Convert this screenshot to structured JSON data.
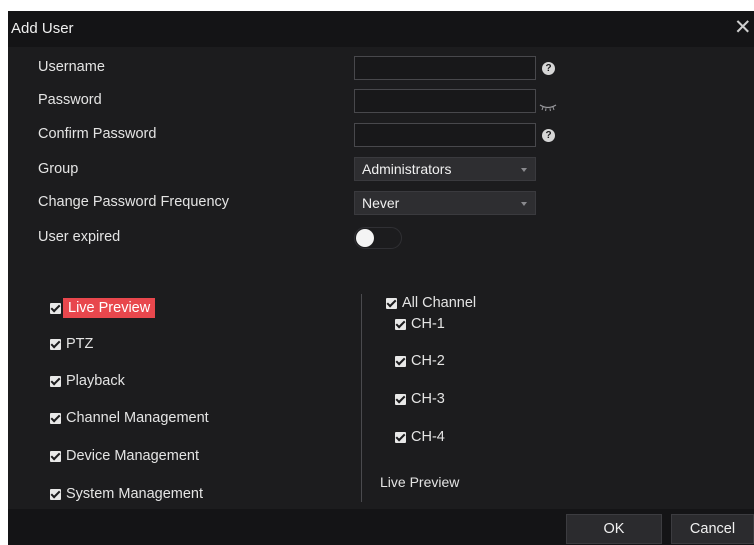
{
  "dialog": {
    "title": "Add User",
    "close_icon": "close-icon"
  },
  "form": {
    "username": {
      "label": "Username",
      "value": "",
      "placeholder": ""
    },
    "password": {
      "label": "Password",
      "value": "",
      "placeholder": ""
    },
    "confirm_password": {
      "label": "Confirm Password",
      "value": "",
      "placeholder": ""
    },
    "group": {
      "label": "Group",
      "value": "Administrators"
    },
    "change_password_frequency": {
      "label": "Change Password Frequency",
      "value": "Never"
    },
    "user_expired": {
      "label": "User expired",
      "enabled": false
    },
    "help_glyph": "?"
  },
  "permissions": [
    {
      "label": "Live Preview",
      "checked": true,
      "selected": true
    },
    {
      "label": "PTZ",
      "checked": true,
      "selected": false
    },
    {
      "label": "Playback",
      "checked": true,
      "selected": false
    },
    {
      "label": "Channel Management",
      "checked": true,
      "selected": false
    },
    {
      "label": "Device Management",
      "checked": true,
      "selected": false
    },
    {
      "label": "System Management",
      "checked": true,
      "selected": false
    }
  ],
  "channels": {
    "all": {
      "label": "All Channel",
      "checked": true
    },
    "items": [
      {
        "label": "CH-1",
        "checked": true
      },
      {
        "label": "CH-2",
        "checked": true
      },
      {
        "label": "CH-3",
        "checked": true
      },
      {
        "label": "CH-4",
        "checked": true
      }
    ],
    "caption": "Live Preview"
  },
  "buttons": {
    "ok": "OK",
    "cancel": "Cancel"
  },
  "colors": {
    "background": "#1c1c1e",
    "bar": "#141416",
    "accent": "#e8474d"
  }
}
